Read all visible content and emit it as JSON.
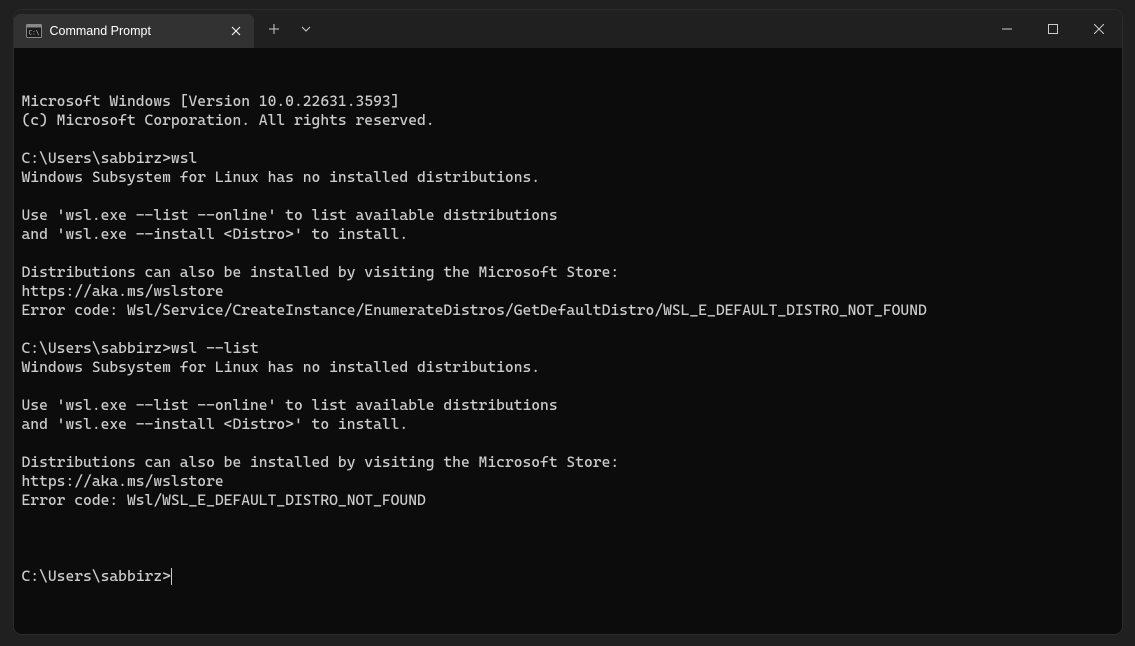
{
  "tab": {
    "title": "Command Prompt"
  },
  "terminal": {
    "lines": [
      "Microsoft Windows [Version 10.0.22631.3593]",
      "(c) Microsoft Corporation. All rights reserved.",
      "",
      "C:\\Users\\sabbirz>wsl",
      "Windows Subsystem for Linux has no installed distributions.",
      "",
      "Use 'wsl.exe --list --online' to list available distributions",
      "and 'wsl.exe --install <Distro>' to install.",
      "",
      "Distributions can also be installed by visiting the Microsoft Store:",
      "https://aka.ms/wslstore",
      "Error code: Wsl/Service/CreateInstance/EnumerateDistros/GetDefaultDistro/WSL_E_DEFAULT_DISTRO_NOT_FOUND",
      "",
      "C:\\Users\\sabbirz>wsl --list",
      "Windows Subsystem for Linux has no installed distributions.",
      "",
      "Use 'wsl.exe --list --online' to list available distributions",
      "and 'wsl.exe --install <Distro>' to install.",
      "",
      "Distributions can also be installed by visiting the Microsoft Store:",
      "https://aka.ms/wslstore",
      "Error code: Wsl/WSL_E_DEFAULT_DISTRO_NOT_FOUND",
      ""
    ],
    "current_prompt": "C:\\Users\\sabbirz>"
  }
}
